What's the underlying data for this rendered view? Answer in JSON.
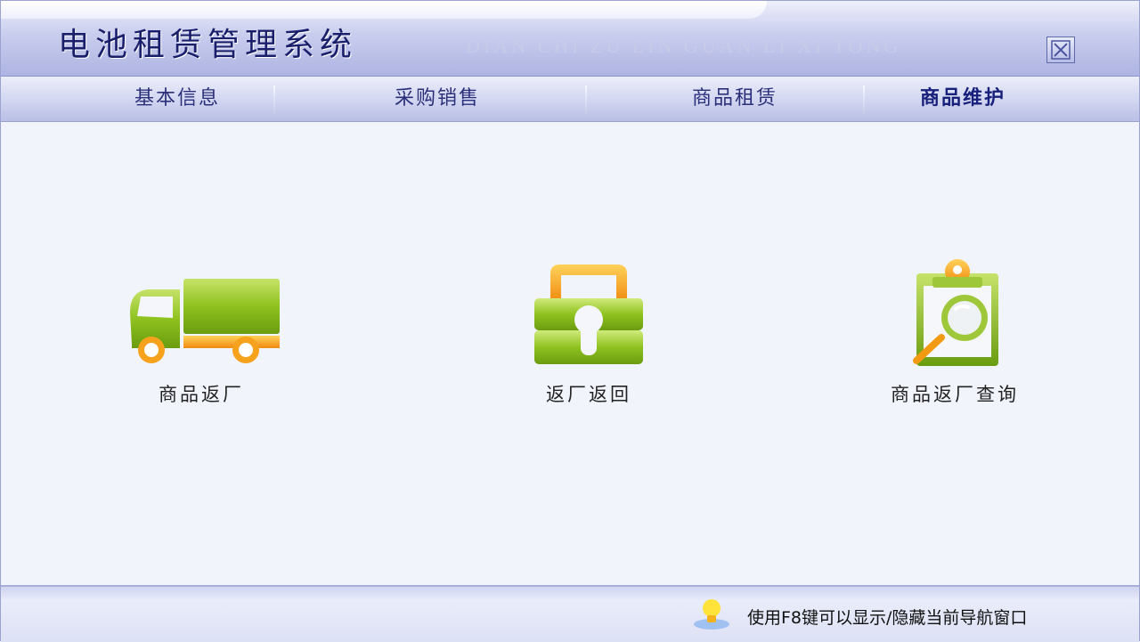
{
  "app": {
    "title": "电池租赁管理系统",
    "subtitle": "DIAN CHI ZU LIN GUAN LI XI TONG"
  },
  "nav": {
    "items": [
      {
        "label": "基本信息",
        "active": false
      },
      {
        "label": "采购销售",
        "active": false
      },
      {
        "label": "商品租赁",
        "active": false
      },
      {
        "label": "商品维护",
        "active": true
      }
    ]
  },
  "tiles": [
    {
      "label": "商品返厂",
      "icon": "truck-icon"
    },
    {
      "label": "返厂返回",
      "icon": "lock-icon"
    },
    {
      "label": "商品返厂查询",
      "icon": "clipboard-search-icon"
    }
  ],
  "footer": {
    "hint": "使用F8键可以显示/隐藏当前导航窗口",
    "icon": "lightbulb-icon"
  },
  "colors": {
    "accent_green": "#8dc21f",
    "accent_orange": "#f39a12",
    "nav_text": "#2a2f7a"
  }
}
